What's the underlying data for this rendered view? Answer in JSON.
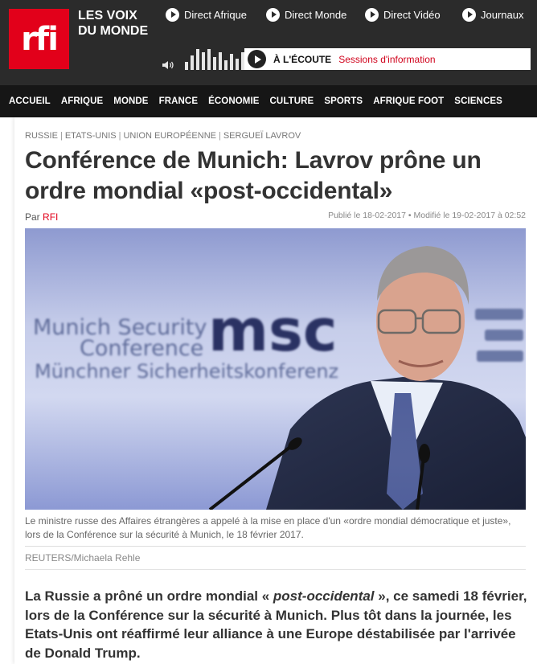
{
  "header": {
    "logo_text": "rfi",
    "tagline_line1": "LES VOIX",
    "tagline_line2": "DU MONDE",
    "direct_links": [
      "Direct Afrique",
      "Direct Monde",
      "Direct Vidéo",
      "Journaux"
    ],
    "player": {
      "listen_label": "À L'ÉCOUTE",
      "program": "Sessions d'information"
    },
    "brand_color": "#e2001a"
  },
  "nav": {
    "items": [
      "ACCUEIL",
      "AFRIQUE",
      "MONDE",
      "FRANCE",
      "ÉCONOMIE",
      "CULTURE",
      "SPORTS",
      "AFRIQUE FOOT",
      "SCIENCES"
    ]
  },
  "article": {
    "tags": [
      "RUSSIE",
      "ETATS-UNIS",
      "UNION EUROPÉENNE",
      "SERGUEÏ LAVROV"
    ],
    "title": "Conférence de Munich: Lavrov prône un ordre mondial «post-occidental»",
    "byline_prefix": "Par",
    "author": "RFI",
    "dates": "Publié le 18-02-2017 • Modifié le 19-02-2017 à 02:52",
    "photo": {
      "backdrop_line1": "Munich Security",
      "backdrop_line2": "Conference",
      "backdrop_line3": "Münchner Sicherheitskonferenz",
      "logo": "msc",
      "caption": "Le ministre russe des Affaires étrangères a appelé à la mise en place d'un «ordre mondial démocratique et juste», lors de la Conférence sur la sécurité à Munich, le 18 février 2017.",
      "credit": "REUTERS/Michaela Rehle"
    },
    "lead_part1": "La Russie a prôné un ordre mondial « ",
    "lead_italic": "post-occidental",
    "lead_part2": " », ce samedi 18 février, lors de la Conférence sur la sécurité à Munich. Plus tôt dans la journée, les Etats-Unis ont réaffirmé leur alliance à une Europe déstabilisée par l'arrivée de Donald Trump."
  }
}
